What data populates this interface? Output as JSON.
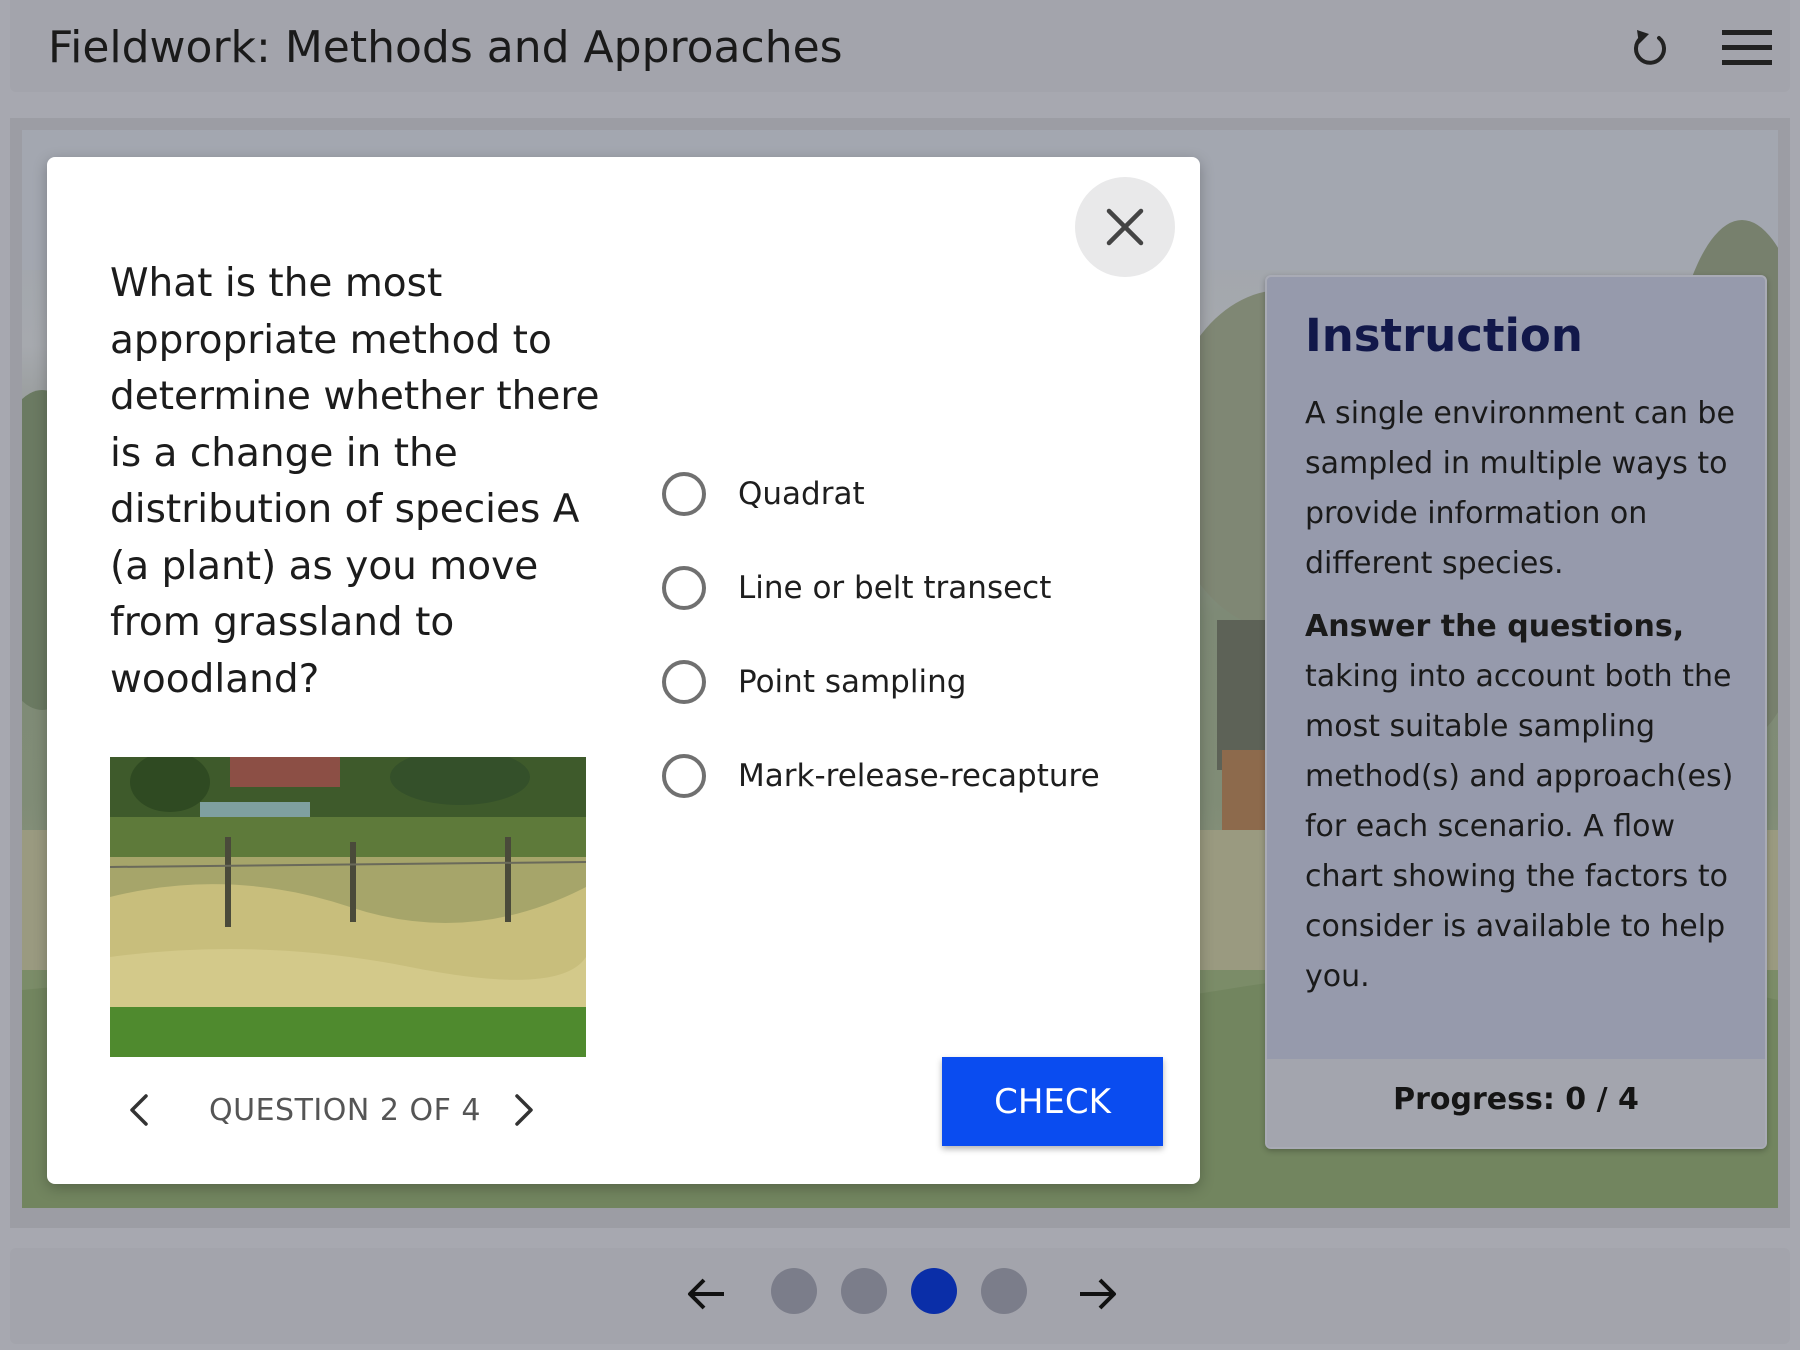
{
  "header": {
    "title": "Fieldwork: Methods and Approaches",
    "reset_icon": "reset-icon",
    "menu_icon": "hamburger-menu-icon"
  },
  "instruction": {
    "title": "Instruction",
    "paragraph1": "A single environment can be sampled in multiple ways to provide information on different species.",
    "paragraph2_bold": "Answer the questions,",
    "paragraph2_rest": " taking into account both the most suitable sampling method(s) and approach(es) for each scenario. A flow chart showing the factors to consider is available to help you.",
    "progress": "Progress: 0 / 4"
  },
  "modal": {
    "close_icon": "close-icon",
    "question": "What is the most appropriate method to determine whether there is a change in the distribution of species A (a plant) as you move from grassland to woodland?",
    "options": [
      {
        "label": "Quadrat",
        "selected": false
      },
      {
        "label": "Line or belt transect",
        "selected": false
      },
      {
        "label": "Point sampling",
        "selected": false
      },
      {
        "label": "Mark-release-recapture",
        "selected": false
      }
    ],
    "check_label": "CHECK",
    "question_counter": "QUESTION 2 OF 4"
  },
  "footer": {
    "pages": 4,
    "current_page": 3
  },
  "colors": {
    "accent_blue": "#0a4cf0",
    "active_dot": "#0a2ea8",
    "instruction_title": "#12184a"
  }
}
